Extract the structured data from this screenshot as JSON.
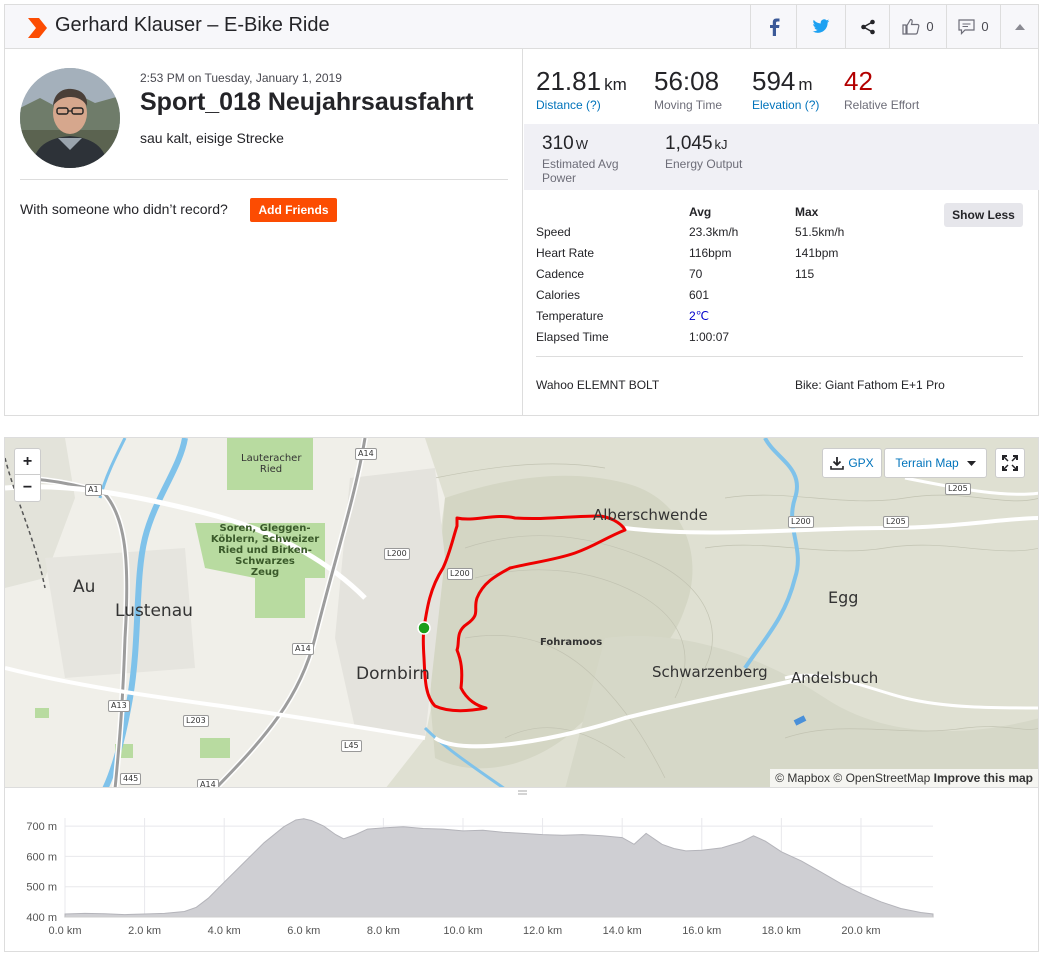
{
  "header": {
    "title": "Gerhard Klauser – E-Bike Ride",
    "kudos_count": "0",
    "comments_count": "0"
  },
  "activity": {
    "datetime": "2:53 PM on Tuesday, January 1, 2019",
    "name": "Sport_018 Neujahrsausfahrt",
    "description": "sau kalt, eisige Strecke",
    "with_someone_text": "With someone who didn’t record?",
    "add_friends_label": "Add Friends"
  },
  "stats": {
    "distance": {
      "value": "21.81",
      "unit": "km",
      "label": "Distance (?)"
    },
    "moving_time": {
      "value": "56:08",
      "label": "Moving Time"
    },
    "elevation": {
      "value": "594",
      "unit": "m",
      "label": "Elevation (?)"
    },
    "relative_effort": {
      "value": "42",
      "label": "Relative Effort"
    },
    "power": {
      "value": "310",
      "unit": "W",
      "label_line1": "Estimated Avg",
      "label_line2": "Power"
    },
    "energy": {
      "value": "1,045",
      "unit": "kJ",
      "label": "Energy Output"
    }
  },
  "details": {
    "avg_header": "Avg",
    "max_header": "Max",
    "show_less_label": "Show Less",
    "rows": [
      {
        "label": "Speed",
        "avg": "23.3km/h",
        "max": "51.5km/h"
      },
      {
        "label": "Heart Rate",
        "avg": "116bpm",
        "max": "141bpm"
      },
      {
        "label": "Cadence",
        "avg": "70",
        "max": "115"
      },
      {
        "label": "Calories",
        "avg": "601",
        "max": ""
      },
      {
        "label": "Temperature",
        "avg": "2℃",
        "max": ""
      },
      {
        "label": "Elapsed Time",
        "avg": "1:00:07",
        "max": ""
      }
    ],
    "device": "Wahoo ELEMNT BOLT",
    "bike": "Bike: Giant Fathom E+1 Pro"
  },
  "map": {
    "zoom_in": "+",
    "zoom_out": "−",
    "gpx_label": "GPX",
    "map_type_label": "Terrain Map",
    "attribution": {
      "mapbox": "© Mapbox",
      "osm": "© OpenStreetMap",
      "improve": "Improve this map"
    },
    "places": {
      "lauteracher": "Lauteracher",
      "ried": "Ried",
      "soren_1": "Soren, Gleggen-",
      "soren_2": "Köblern, Schweizer",
      "soren_3": "Ried und Birken-",
      "soren_4": "Schwarzes",
      "soren_5": "Zeug",
      "au": "Au",
      "lustenau": "Lustenau",
      "dornbirn": "Dornbirn",
      "alberschwende": "Alberschwende",
      "egg": "Egg",
      "fohramoos": "Fohramoos",
      "schwarzenberg": "Schwarzenberg",
      "andelsbuch": "Andelsbuch"
    },
    "roads": {
      "a14_top": "A14",
      "a1": "A1",
      "l200_a": "L200",
      "l200_b": "L200",
      "l200_c": "L200",
      "l205_a": "L205",
      "l205_b": "L205",
      "a14_mid": "A14",
      "a13": "A13",
      "l203": "L203",
      "l45": "L45",
      "r445": "445",
      "a14_bot": "A14"
    }
  },
  "elevation_chart": {
    "y_ticks": [
      "400 m",
      "500 m",
      "600 m",
      "700 m"
    ],
    "x_ticks": [
      "0.0 km",
      "2.0 km",
      "4.0 km",
      "6.0 km",
      "8.0 km",
      "10.0 km",
      "12.0 km",
      "14.0 km",
      "16.0 km",
      "18.0 km",
      "20.0 km"
    ]
  },
  "chart_data": {
    "type": "area",
    "xlabel": "",
    "ylabel": "",
    "xlim": [
      0,
      21.81
    ],
    "ylim": [
      400,
      730
    ],
    "grid": true,
    "x": [
      0,
      0.5,
      1.0,
      1.5,
      2.0,
      2.5,
      3.0,
      3.3,
      3.6,
      4.0,
      4.5,
      5.0,
      5.5,
      5.8,
      6.0,
      6.2,
      6.5,
      6.8,
      7.0,
      7.3,
      7.6,
      8.0,
      8.5,
      9.0,
      9.5,
      10.0,
      10.5,
      11.0,
      11.5,
      12.0,
      12.5,
      13.0,
      13.5,
      14.0,
      14.3,
      14.6,
      15.0,
      15.3,
      15.6,
      16.0,
      16.5,
      17.0,
      17.3,
      17.6,
      18.0,
      18.5,
      19.0,
      19.5,
      20.0,
      20.5,
      21.0,
      21.5,
      21.81
    ],
    "y": [
      410,
      412,
      411,
      408,
      410,
      412,
      418,
      432,
      462,
      515,
      580,
      645,
      698,
      720,
      724,
      718,
      700,
      672,
      658,
      672,
      690,
      694,
      698,
      692,
      690,
      684,
      686,
      680,
      676,
      672,
      670,
      672,
      668,
      662,
      640,
      676,
      640,
      626,
      618,
      620,
      628,
      648,
      668,
      650,
      615,
      585,
      548,
      510,
      478,
      450,
      428,
      415,
      410
    ]
  }
}
